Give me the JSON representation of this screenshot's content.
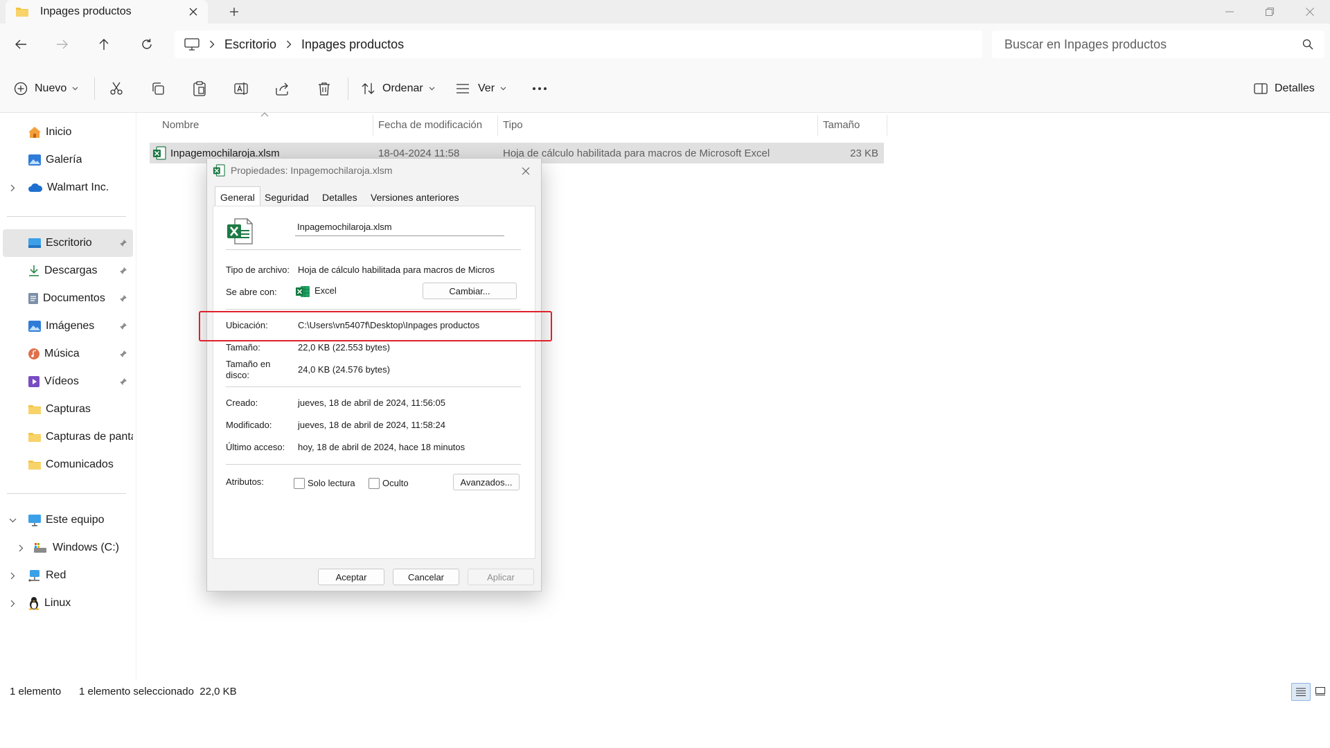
{
  "window": {
    "tab_title": "Inpages productos",
    "new_tab": "+"
  },
  "address": {
    "crumbs": [
      "Escritorio",
      "Inpages productos"
    ],
    "search_placeholder": "Buscar en Inpages productos"
  },
  "commandbar": {
    "new_label": "Nuevo",
    "sort_label": "Ordenar",
    "view_label": "Ver",
    "more_label": "···",
    "details_label": "Detalles"
  },
  "sidebar": {
    "items": [
      {
        "label": "Inicio",
        "icon": "home-icon"
      },
      {
        "label": "Galería",
        "icon": "gallery-icon"
      },
      {
        "label": "Walmart Inc.",
        "icon": "cloud-icon"
      },
      {
        "label": "Escritorio",
        "icon": "desktop-icon",
        "pinned": true
      },
      {
        "label": "Descargas",
        "icon": "download-icon",
        "pinned": true
      },
      {
        "label": "Documentos",
        "icon": "documents-icon",
        "pinned": true
      },
      {
        "label": "Imágenes",
        "icon": "pictures-icon",
        "pinned": true
      },
      {
        "label": "Música",
        "icon": "music-icon",
        "pinned": true
      },
      {
        "label": "Vídeos",
        "icon": "videos-icon",
        "pinned": true
      },
      {
        "label": "Capturas",
        "icon": "folder-icon"
      },
      {
        "label": "Capturas de pantalla",
        "icon": "folder-icon"
      },
      {
        "label": "Comunicados",
        "icon": "folder-icon"
      },
      {
        "label": "Este equipo",
        "icon": "computer-icon"
      },
      {
        "label": "Windows (C:)",
        "icon": "drive-icon"
      },
      {
        "label": "Red",
        "icon": "network-icon"
      },
      {
        "label": "Linux",
        "icon": "linux-icon"
      }
    ]
  },
  "filelist": {
    "columns": [
      "Nombre",
      "Fecha de modificación",
      "Tipo",
      "Tamaño"
    ],
    "rows": [
      {
        "name": "Inpagemochilaroja.xlsm",
        "modified": "18-04-2024 11:58",
        "type": "Hoja de cálculo habilitada para macros de Microsoft Excel",
        "size": "23 KB"
      }
    ]
  },
  "status": {
    "count": "1 elemento",
    "selection": "1 elemento seleccionado  22,0 KB"
  },
  "dialog": {
    "title": "Propiedades: Inpagemochilaroja.xlsm",
    "tabs": [
      "General",
      "Seguridad",
      "Detalles",
      "Versiones anteriores"
    ],
    "filename": "Inpagemochilaroja.xlsm",
    "labels": {
      "type": "Tipo de archivo:",
      "opens_with": "Se abre con:",
      "location": "Ubicación:",
      "size": "Tamaño:",
      "size_on_disk": "Tamaño en disco:",
      "created": "Creado:",
      "modified": "Modificado:",
      "accessed": "Último acceso:",
      "attributes": "Atributos:"
    },
    "values": {
      "type": "Hoja de cálculo habilitada para macros de Micros",
      "opens_with": "Excel",
      "location": "C:\\Users\\vn5407f\\Desktop\\Inpages productos",
      "size": "22,0 KB (22.553 bytes)",
      "size_on_disk": "24,0 KB (24.576 bytes)",
      "created": "jueves, 18 de abril de 2024, 11:56:05",
      "modified": "jueves, 18 de abril de 2024, 11:58:24",
      "accessed": "hoy, 18 de abril de 2024, hace 18 minutos"
    },
    "change_button": "Cambiar...",
    "readonly_label": "Solo lectura",
    "hidden_label": "Oculto",
    "advanced_button": "Avanzados...",
    "ok_button": "Aceptar",
    "cancel_button": "Cancelar",
    "apply_button": "Aplicar"
  },
  "colors": {
    "highlight": "#e0202a",
    "excel_green": "#1d7a45",
    "folder_yellow": "#f4c542"
  }
}
